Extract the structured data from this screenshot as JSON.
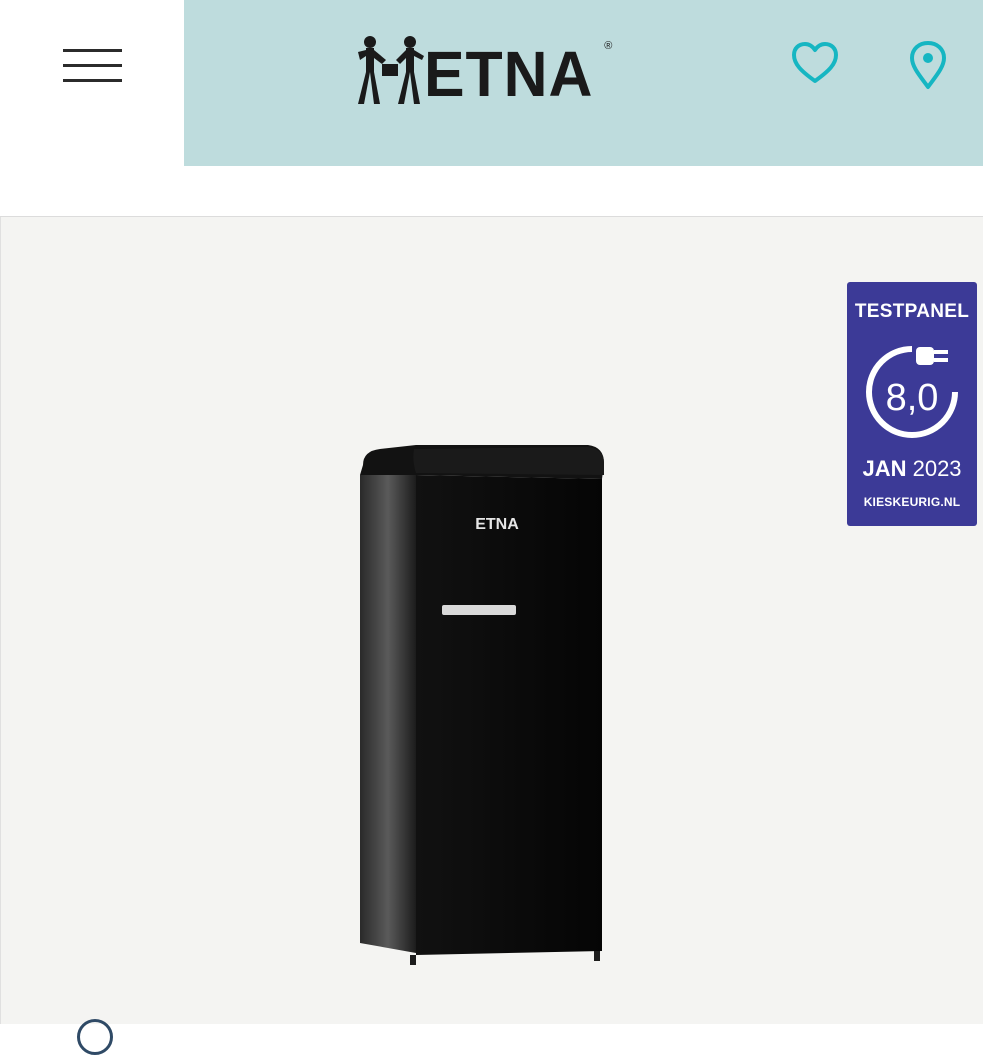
{
  "header": {
    "brand": "ETNA",
    "colors": {
      "bar": "#bedcdd",
      "accent": "#16b6c2"
    },
    "icons": [
      "menu-icon",
      "heart-icon",
      "location-pin-icon"
    ]
  },
  "product": {
    "name": "",
    "brand_on_product": "ETNA",
    "color": "#0b0b0b"
  },
  "badge": {
    "title": "TESTPANEL",
    "score": "8,0",
    "month": "JAN",
    "year": "2023",
    "site": "KIESKEURIG.NL",
    "color": "#3c3a97"
  }
}
